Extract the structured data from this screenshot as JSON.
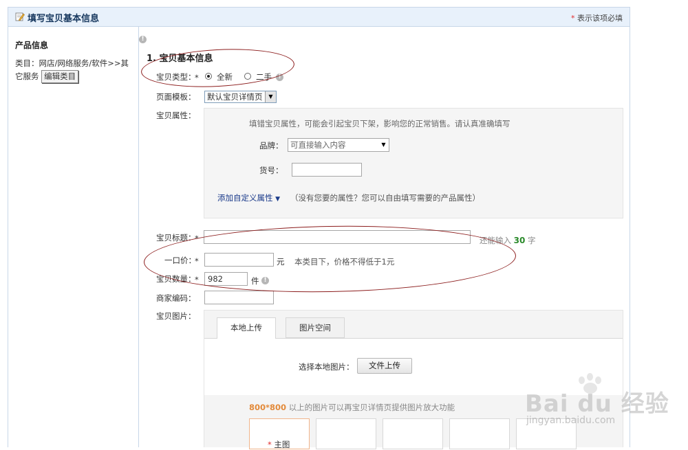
{
  "header": {
    "title": "填写宝贝基本信息",
    "required_star": "*",
    "required_note": "表示该项必填"
  },
  "sidebar": {
    "title": "产品信息",
    "category_text": "类目：网店/网络服务/软件>>其它服务",
    "edit_category_label": "编辑类目"
  },
  "section": {
    "title": "1. 宝贝基本信息"
  },
  "form": {
    "item_type_label": "宝贝类型：",
    "item_type_options": [
      "全新",
      "二手"
    ],
    "item_type_selected": "全新",
    "template_label": "页面模板：",
    "template_value": "默认宝贝详情页",
    "attributes_label": "宝贝属性：",
    "attributes_hint": "填错宝贝属性，可能会引起宝贝下架，影响您的正常销售。请认真准确填写",
    "brand_label": "品牌：",
    "brand_placeholder": "可直接输入内容",
    "sku_label": "货号：",
    "sku_value": "",
    "custom_attr_link": "添加自定义属性",
    "custom_attr_hint": "（没有您要的属性？您可以自由填写需要的产品属性）",
    "title_label": "宝贝标题：",
    "title_value": "",
    "title_remaining_prefix": "还能输入",
    "title_remaining_count": "30",
    "title_remaining_suffix": "字",
    "price_label": "一口价：",
    "price_value": "",
    "price_unit": "元",
    "price_hint": "本类目下，价格不得低于1元",
    "quantity_label": "宝贝数量：",
    "quantity_value": "982",
    "quantity_unit": "件",
    "merchant_code_label": "商家编码：",
    "merchant_code_value": "",
    "images_label": "宝贝图片："
  },
  "images": {
    "tabs": [
      "本地上传",
      "图片空间"
    ],
    "active_tab": "本地上传",
    "select_local_label": "选择本地图片：",
    "upload_button": "文件上传",
    "zoom_size": "800*800",
    "zoom_hint": "以上的图片可以再宝贝详情页提供图片放大功能",
    "main_image_label": "主图"
  },
  "watermark": {
    "brand": "Bai du 经验",
    "url": "jingyan.baidu.com"
  },
  "colors": {
    "required": "#e12b2b",
    "header_bg": "#e8f1fb",
    "annotation_ellipse": "#8b1b1b",
    "link": "#1a3a8a",
    "count_green": "#2a8a2a",
    "zoom_orange": "#e38a3a"
  }
}
